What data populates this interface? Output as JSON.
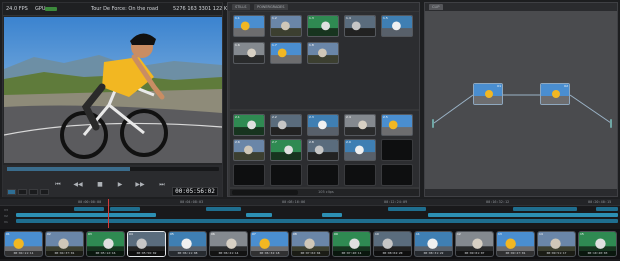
{
  "viewer": {
    "fps": "24.0 FPS",
    "gpu_label": "GPU",
    "clip_title": "Tour De Force: On the road",
    "clip_info": "5276 163 3301  122 KD",
    "timecode": "00:05:56:02",
    "playback_progress": 0.58
  },
  "browser": {
    "tabs": [
      "STILLS",
      "POWERGRADES"
    ],
    "clip_count": "105 clips",
    "upper_thumbs": [
      "1.1",
      "1.2",
      "1.3",
      "1.4",
      "1.5",
      "1.6",
      "1.7",
      "1.8"
    ],
    "lower_thumbs": [
      "2.1",
      "2.2",
      "2.3",
      "2.4",
      "2.5",
      "2.6",
      "2.7",
      "2.8",
      "2.9",
      "",
      "",
      "",
      "",
      "",
      "",
      ""
    ]
  },
  "nodes": {
    "tab": "CLIP",
    "node1_label": "01",
    "node2_label": "02"
  },
  "timeline": {
    "timecodes": [
      "00:00:00:00",
      "00:04:08:03",
      "00:08:16:06",
      "00:12:24:09",
      "00:16:32:12",
      "00:20:40:15"
    ],
    "track_labels": [
      "V3",
      "V2",
      "V1"
    ],
    "clips": [
      {
        "label": "01",
        "tc": "00:04:11:11"
      },
      {
        "label": "02",
        "tc": "00:04:37:01"
      },
      {
        "label": "03",
        "tc": "00:05:12:16"
      },
      {
        "label": "04",
        "tc": "00:05:56:02"
      },
      {
        "label": "05",
        "tc": "00:06:11:08"
      },
      {
        "label": "06",
        "tc": "00:06:21:14"
      },
      {
        "label": "07",
        "tc": "00:06:34:18"
      },
      {
        "label": "08",
        "tc": "00:07:02:04"
      },
      {
        "label": "09",
        "tc": "00:07:40:11"
      },
      {
        "label": "10",
        "tc": "00:08:04:20"
      },
      {
        "label": "11",
        "tc": "00:08:31:22"
      },
      {
        "label": "12",
        "tc": "00:09:01:07"
      },
      {
        "label": "13",
        "tc": "00:09:27:01"
      },
      {
        "label": "14",
        "tc": "00:09:51:17"
      },
      {
        "label": "15",
        "tc": "00:10:20:03"
      }
    ]
  },
  "colors": {
    "accent": "#2c8fb3",
    "playhead": "#d23b3b",
    "panel": "#2c2d30"
  }
}
